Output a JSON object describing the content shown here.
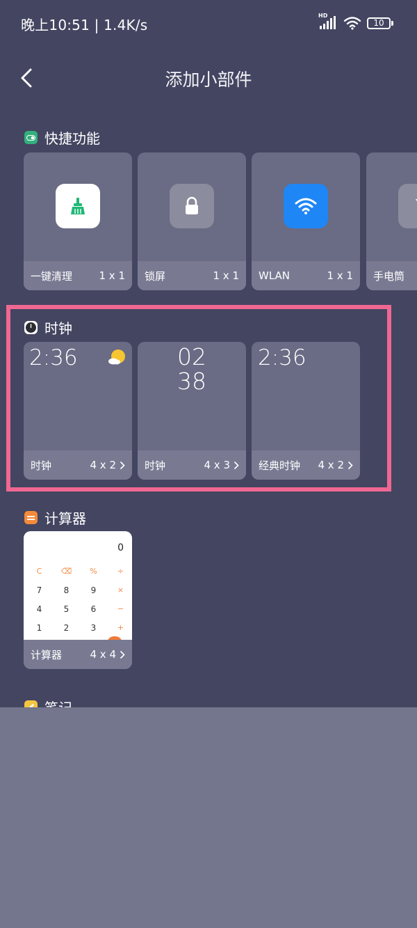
{
  "status": {
    "time": "晚上10:51 | 1.4K/s",
    "hd_label": "HD",
    "battery_level": "10"
  },
  "header": {
    "title": "添加小部件"
  },
  "sections": {
    "quick": {
      "title": "快捷功能",
      "items": [
        {
          "name": "一键清理",
          "size": "1 x 1"
        },
        {
          "name": "锁屏",
          "size": "1 x 1"
        },
        {
          "name": "WLAN",
          "size": "1 x 1"
        },
        {
          "name": "手电筒",
          "size": ""
        }
      ]
    },
    "clock": {
      "title": "时钟",
      "items": [
        {
          "preview": "2:36",
          "name": "时钟",
          "size": "4 x 2"
        },
        {
          "preview_hour": "02",
          "preview_minute": "38",
          "name": "时钟",
          "size": "4 x 3"
        },
        {
          "preview": "2:36",
          "name": "经典时钟",
          "size": "4 x 2"
        }
      ]
    },
    "calculator": {
      "title": "计算器",
      "display": "0",
      "keys": [
        [
          "C",
          "⌫",
          "%",
          "÷"
        ],
        [
          "7",
          "8",
          "9",
          "×"
        ],
        [
          "4",
          "5",
          "6",
          "−"
        ],
        [
          "1",
          "2",
          "3",
          "+"
        ]
      ],
      "name": "计算器",
      "size": "4 x 4"
    },
    "notes": {
      "title": "笔记"
    }
  },
  "colors": {
    "background": "#434561",
    "card": "#6a6b84",
    "card_footer": "#797a92",
    "highlight": "#f06892",
    "quick_icon": "#33b07d",
    "wifi_tile": "#1f86f5",
    "calc_icon": "#f58a3a",
    "notes_icon": "#f5c542"
  }
}
